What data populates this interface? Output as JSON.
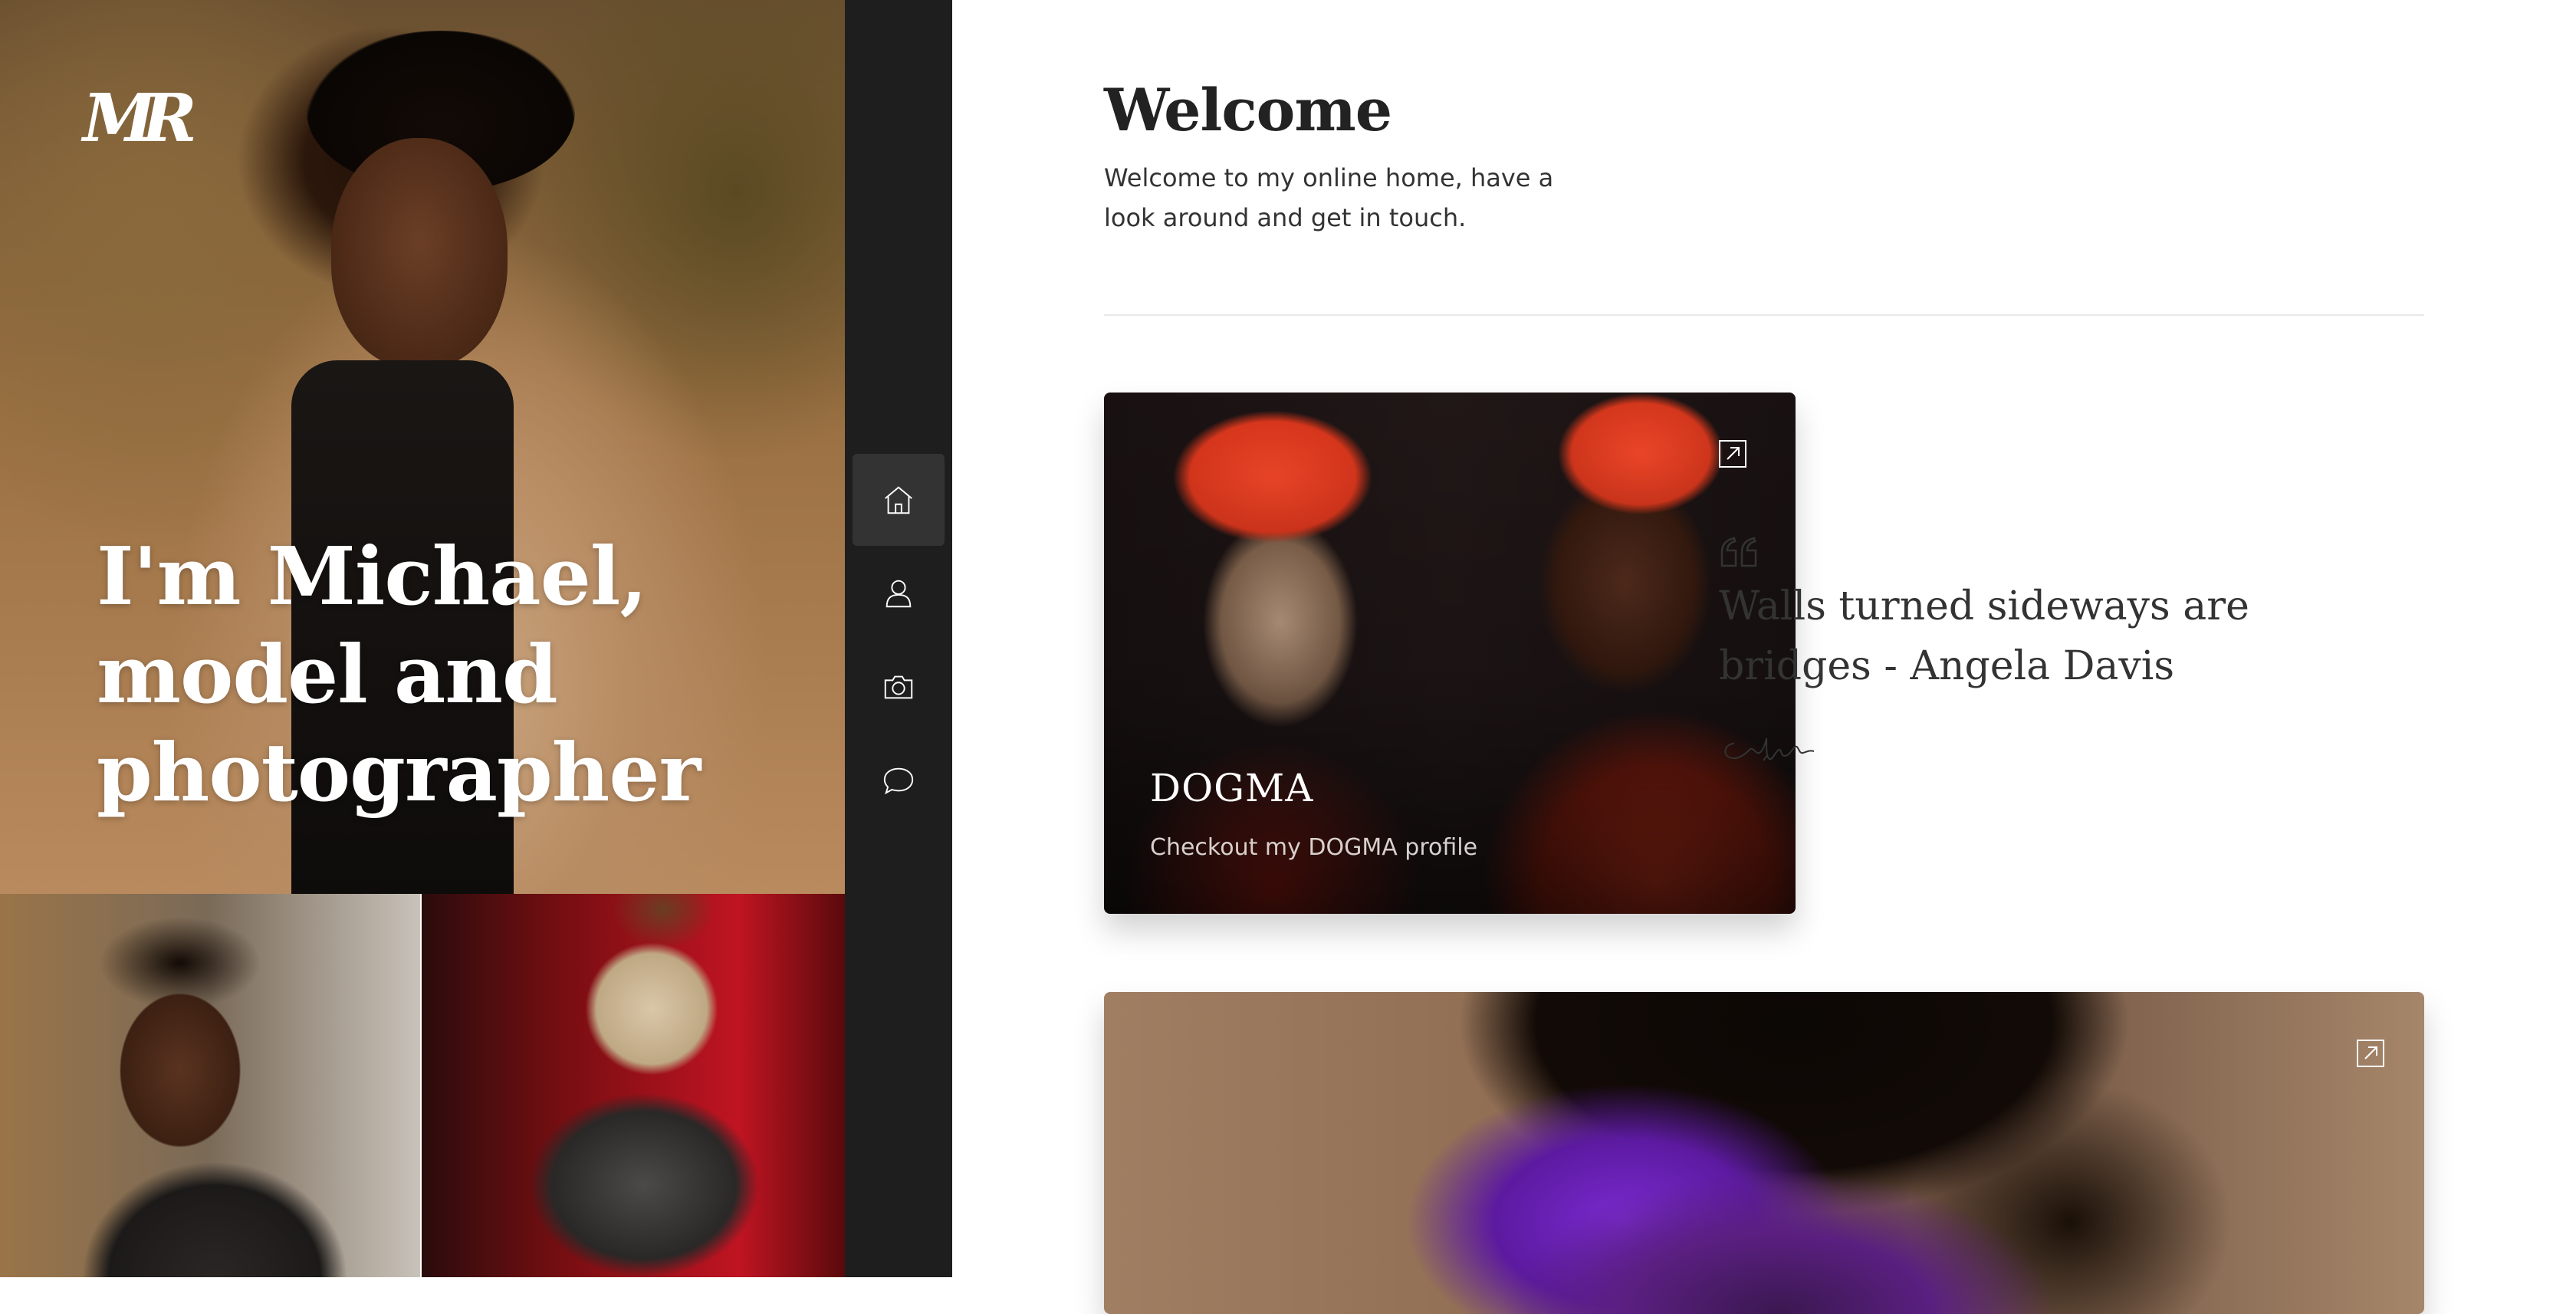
{
  "logo": {
    "text": "MR"
  },
  "hero": {
    "title": "I'm Michael, model and photographer"
  },
  "nav": {
    "items": [
      {
        "icon": "home-icon",
        "label": "Home",
        "active": true
      },
      {
        "icon": "user-icon",
        "label": "About",
        "active": false
      },
      {
        "icon": "camera-icon",
        "label": "Portfolio",
        "active": false
      },
      {
        "icon": "chat-icon",
        "label": "Contact",
        "active": false
      }
    ]
  },
  "welcome": {
    "title": "Welcome",
    "text": "Welcome to my online home, have a look around and get in touch."
  },
  "cards": {
    "dogma": {
      "title": "DOGMA",
      "subtitle": "Checkout my DOGMA profile",
      "icon": "external-link-icon"
    },
    "portrait": {
      "icon": "external-link-icon"
    }
  },
  "quote": {
    "text": "Walls turned sideways are bridges - Angela Davis",
    "icon": "quote-icon"
  },
  "colors": {
    "rail_bg": "#1e1e1e",
    "rail_active": "#333333",
    "text_dark": "#222222",
    "divider": "#e8e8e8"
  }
}
